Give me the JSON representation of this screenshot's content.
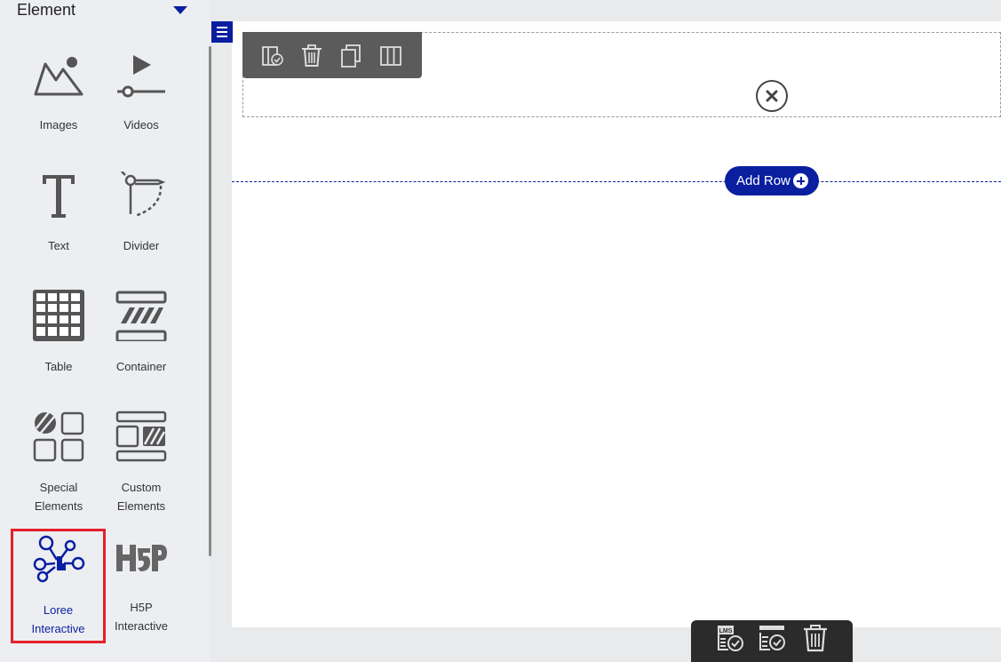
{
  "sidebar": {
    "header": "Element",
    "tiles": [
      {
        "label": "Images",
        "icon": "image-icon"
      },
      {
        "label": "Videos",
        "icon": "video-icon"
      },
      {
        "label": "Text",
        "icon": "text-icon"
      },
      {
        "label": "Divider",
        "icon": "divider-icon"
      },
      {
        "label": "Table",
        "icon": "table-icon"
      },
      {
        "label": "Container",
        "icon": "container-icon"
      },
      {
        "label": "Special",
        "label2": "Elements",
        "icon": "special-elements-icon"
      },
      {
        "label": "Custom",
        "label2": "Elements",
        "icon": "custom-elements-icon"
      },
      {
        "label": "Loree",
        "label2": "Interactive",
        "icon": "loree-interactive-icon",
        "selected": true
      },
      {
        "label": "H5P",
        "label2": "Interactive",
        "icon": "h5p-icon"
      }
    ]
  },
  "canvas": {
    "add_row_label": "Add Row"
  },
  "row_toolbar": {
    "buttons": [
      "column-layout-icon",
      "trash-icon",
      "copy-icon",
      "columns-icon"
    ]
  },
  "bottom_bar": {
    "lms_label": "LMS",
    "buttons": [
      "lms-save-icon",
      "save-icon",
      "trash-icon"
    ]
  },
  "colors": {
    "accent": "#0a1fa0",
    "selection": "#e3202a",
    "toolbar": "#5b5b5b",
    "bottom_bar": "#2b2b2b"
  }
}
